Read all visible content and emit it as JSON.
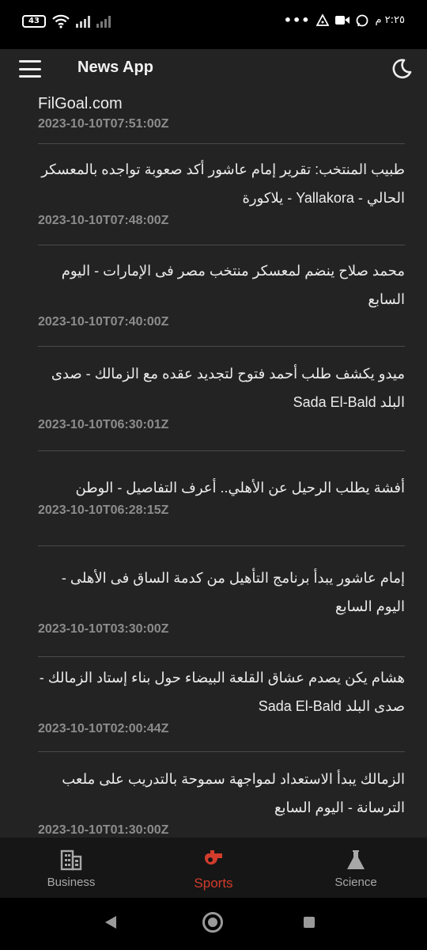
{
  "status_bar": {
    "battery": "43",
    "time": "٢:٢٥ م",
    "overflow": "•••"
  },
  "app_bar": {
    "title": "News App",
    "menu_icon": "hamburger-menu-icon",
    "theme_icon": "moon-icon"
  },
  "articles": [
    {
      "title": "FilGoal.com",
      "date": "2023-10-10T07:51:00Z",
      "rtl": false
    },
    {
      "title": "طبيب المنتخب: تقرير إمام عاشور أكد صعوبة تواجده بالمعسكر الحالي - Yallakora - يلاكورة",
      "date": "2023-10-10T07:48:00Z",
      "rtl": true
    },
    {
      "title": "محمد صلاح ينضم لمعسكر منتخب مصر فى الإمارات - اليوم السابع",
      "date": "2023-10-10T07:40:00Z",
      "rtl": true
    },
    {
      "title": "ميدو يكشف طلب أحمد فتوح لتجديد عقده مع الزمالك - صدى البلد Sada El-Bald",
      "date": "2023-10-10T06:30:01Z",
      "rtl": true
    },
    {
      "title": "أفشة يطلب الرحيل عن الأهلي.. أعرف التفاصيل - الوطن",
      "date": "2023-10-10T06:28:15Z",
      "rtl": true
    },
    {
      "title": "إمام عاشور يبدأ برنامج التأهيل من كدمة الساق فى الأهلى - اليوم السابع",
      "date": "2023-10-10T03:30:00Z",
      "rtl": true
    },
    {
      "title": "هشام يكن يصدم عشاق القلعة البيضاء حول بناء إستاد الزمالك - صدى البلد Sada El-Bald",
      "date": "2023-10-10T02:00:44Z",
      "rtl": true
    },
    {
      "title": "الزمالك يبدأ الاستعداد لمواجهة سموحة بالتدريب على ملعب الترسانة - اليوم السابع",
      "date": "2023-10-10T01:30:00Z",
      "rtl": true
    }
  ],
  "bottom_nav": [
    {
      "label": "Business",
      "icon": "building-icon",
      "active": false
    },
    {
      "label": "Sports",
      "icon": "whistle-icon",
      "active": true
    },
    {
      "label": "Science",
      "icon": "flask-icon",
      "active": false
    }
  ],
  "colors": {
    "background": "#232323",
    "nav_background": "#161616",
    "accent": "#d23c2c",
    "date_text": "#8c8c8c"
  }
}
